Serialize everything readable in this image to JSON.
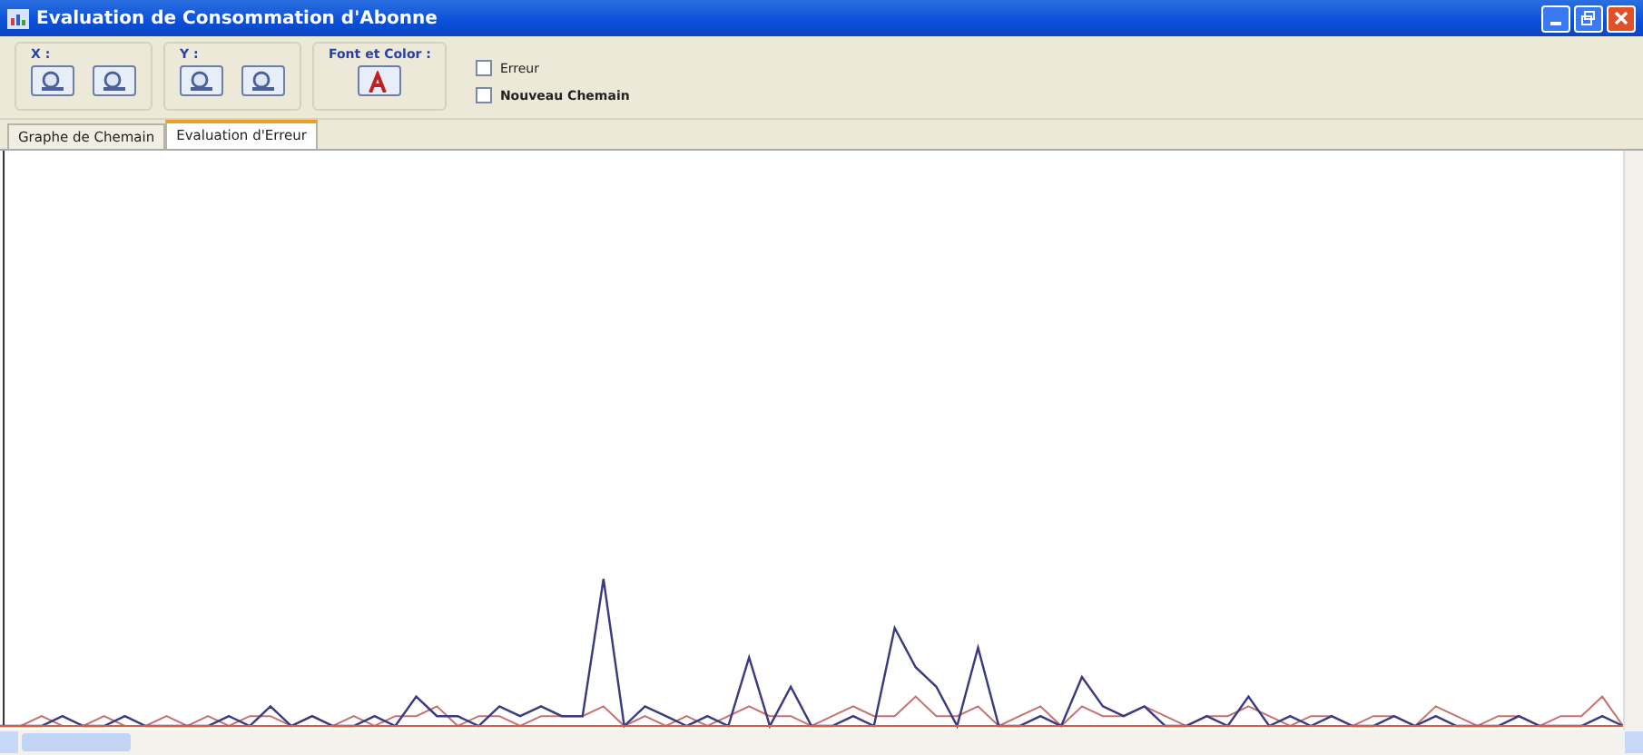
{
  "window": {
    "title": "Evaluation de Consommation d'Abonne"
  },
  "toolbar": {
    "groups": [
      {
        "label": "X :",
        "kind": "zoom"
      },
      {
        "label": "Y :",
        "kind": "zoom"
      },
      {
        "label": "Font et Color :",
        "kind": "font"
      }
    ],
    "checkboxes": [
      {
        "label": "Erreur",
        "checked": false,
        "bold": false
      },
      {
        "label": "Nouveau Chemain",
        "checked": false,
        "bold": true
      }
    ]
  },
  "tabs": [
    {
      "label": "Graphe de Chemain",
      "selected": false
    },
    {
      "label": "Evaluation d'Erreur",
      "selected": true
    }
  ]
}
